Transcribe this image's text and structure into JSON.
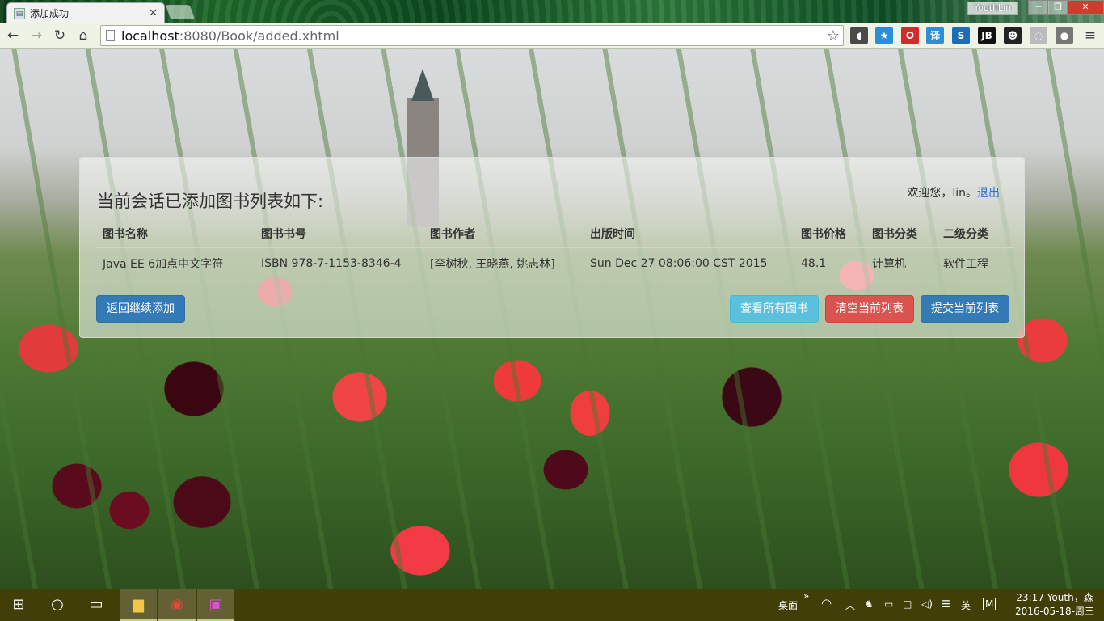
{
  "browser": {
    "tab_title": "添加成功",
    "tab_favicon": "page-icon",
    "profile_name": "YouthLin",
    "url_host": "localhost",
    "url_rest": ":8080/Book/added.xhtml",
    "window_buttons": [
      "minimize",
      "restore",
      "close"
    ],
    "nav_icons": [
      "back-arrow-icon",
      "forward-arrow-icon",
      "reload-icon",
      "home-icon"
    ],
    "extensions": [
      {
        "name": "pocket-icon",
        "glyph": "◖",
        "color": "#4a4a4a"
      },
      {
        "name": "bookmark-star-icon",
        "glyph": "★",
        "color": "#2a8fd8"
      },
      {
        "name": "opera-icon",
        "glyph": "O",
        "color": "#d12b2b"
      },
      {
        "name": "dictionary-icon",
        "glyph": "译",
        "color": "#2e8fd8"
      },
      {
        "name": "s-extension-icon",
        "glyph": "S",
        "color": "#1d6fb5"
      },
      {
        "name": "jetbrains-icon",
        "glyph": "JB",
        "color": "#111111"
      },
      {
        "name": "tampermonkey-icon",
        "glyph": "☻",
        "color": "#222222"
      },
      {
        "name": "translate-icon",
        "glyph": "◌",
        "color": "#bbbbbb"
      },
      {
        "name": "user-extension-icon",
        "glyph": "●",
        "color": "#777777"
      }
    ]
  },
  "panel": {
    "title": "当前会话已添加图书列表如下:",
    "welcome_prefix": "欢迎您，lin。",
    "logout_label": "退出",
    "columns": [
      "图书名称",
      "图书书号",
      "图书作者",
      "出版时间",
      "图书价格",
      "图书分类",
      "二级分类"
    ],
    "rows": [
      [
        "Java EE 6加点中文字符",
        "ISBN 978-7-1153-8346-4",
        "[李树秋, 王晓燕, 姚志林]",
        "Sun Dec 27 08:06:00 CST 2015",
        "48.1",
        "计算机",
        "软件工程"
      ]
    ],
    "buttons": {
      "back": "返回继续添加",
      "view_all": "查看所有图书",
      "clear": "清空当前列表",
      "submit": "提交当前列表"
    }
  },
  "taskbar": {
    "desktop_label": "桌面",
    "ime_label": "英",
    "ime_mode": "M",
    "time": "23:17 Youth，森",
    "date": "2016-05-18-周三"
  }
}
